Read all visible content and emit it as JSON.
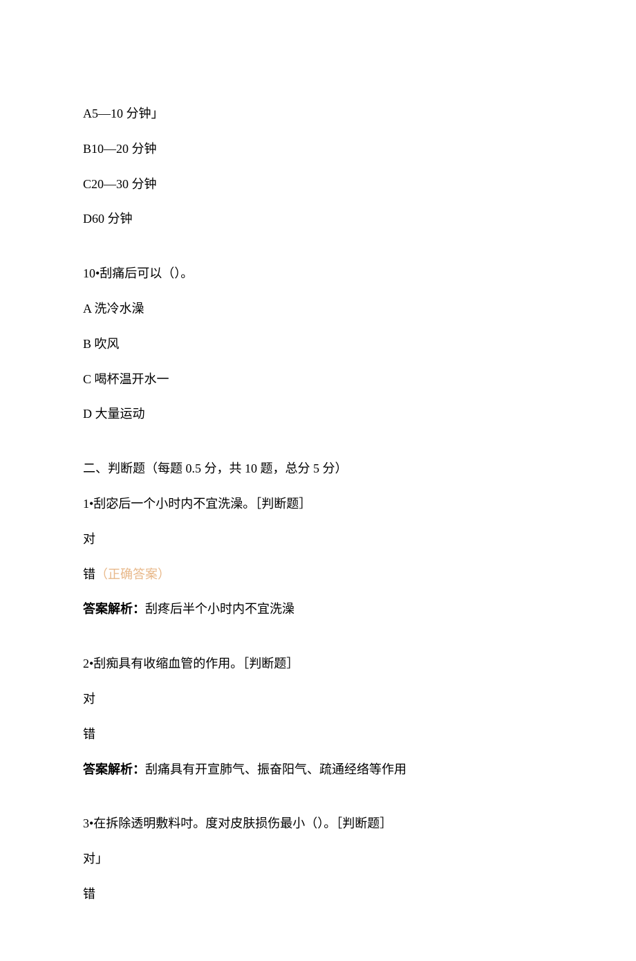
{
  "q9": {
    "optionA": "A5—10 分钟」",
    "optionB": "B10—20 分钟",
    "optionC": "C20—30 分钟",
    "optionD": "D60 分钟"
  },
  "q10": {
    "stem": "10•刮痛后可以（）。",
    "optionA": "A 洗冷水澡",
    "optionB": "B 吹风",
    "optionC": "C 喝杯温开水一",
    "optionD": "D 大量运动"
  },
  "section2": {
    "heading": "二、判断题（每题 0.5 分，共 10 题，总分 5 分）"
  },
  "j1": {
    "stem": "1•刮宓后一个小时内不宜洗澡。［判断题］",
    "true": "对",
    "false": "错",
    "correctLabel": "（正确答案）",
    "analysisLabel": "答案解析：",
    "analysisText": "刮疼后半个小时内不宜洗澡"
  },
  "j2": {
    "stem": "2•刮痴具有收缩血管的作用。［判断题］",
    "true": "对",
    "false": "错",
    "analysisLabel": "答案解析：",
    "analysisText": "刮痛具有开宣肺气、振奋阳气、疏通经络等作用"
  },
  "j3": {
    "stem": "3•在拆除透明敷料吋。度对皮肤损伤最小（）。［判断题］",
    "true": "对」",
    "false": "错"
  }
}
